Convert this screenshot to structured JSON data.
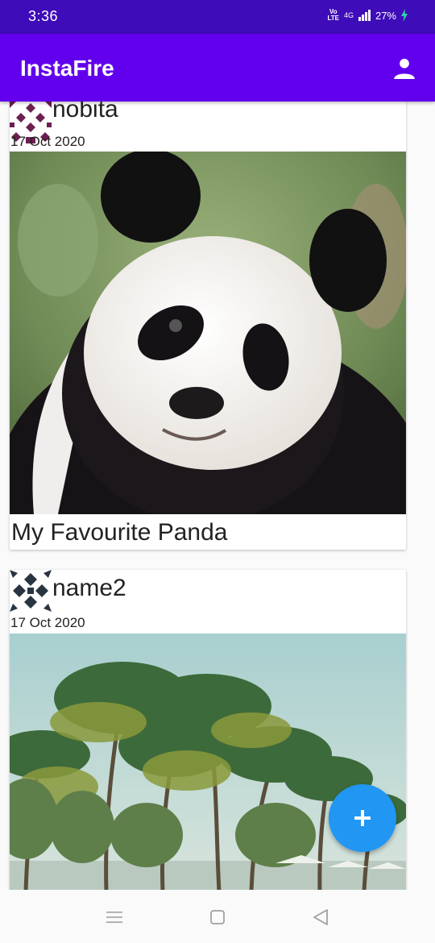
{
  "status_bar": {
    "time": "3:36",
    "network_type": "4G",
    "volte": "Vo LTE",
    "battery": "27%"
  },
  "app_bar": {
    "title": "InstaFire",
    "profile_icon": "person-icon"
  },
  "posts": [
    {
      "username": "nobita",
      "date": "17 Oct 2020",
      "image": "panda photo",
      "caption": "My Favourite Panda"
    },
    {
      "username": "name2",
      "date": "17 Oct 2020",
      "image": "palm trees beach photo",
      "caption": ""
    }
  ],
  "fab": {
    "icon": "plus-icon"
  },
  "nav_bar": {
    "icons": [
      "menu-icon",
      "home-square-icon",
      "back-triangle-icon"
    ]
  },
  "colors": {
    "status_bar": "#3e0cb8",
    "app_bar": "#6200ee",
    "fab": "#2196f3"
  }
}
